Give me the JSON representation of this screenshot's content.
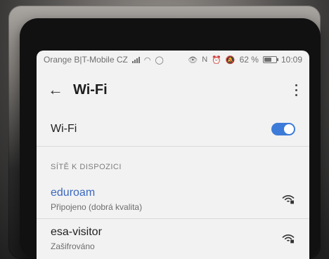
{
  "status_bar": {
    "carrier": "Orange B|T-Mobile CZ",
    "battery_percent": "62 %",
    "time": "10:09"
  },
  "header": {
    "title": "Wi-Fi"
  },
  "wifi_toggle": {
    "label": "Wi-Fi",
    "enabled": true,
    "accent_color": "#3d7bd8"
  },
  "section": {
    "title": "SÍTĚ K DISPOZICI"
  },
  "networks": [
    {
      "name": "eduroam",
      "status": "Připojeno (dobrá kvalita)",
      "connected": true,
      "icon": "wifi-lock-icon"
    },
    {
      "name": "esa-visitor",
      "status": "Zašifrováno",
      "connected": false,
      "icon": "wifi-lock-icon"
    }
  ]
}
